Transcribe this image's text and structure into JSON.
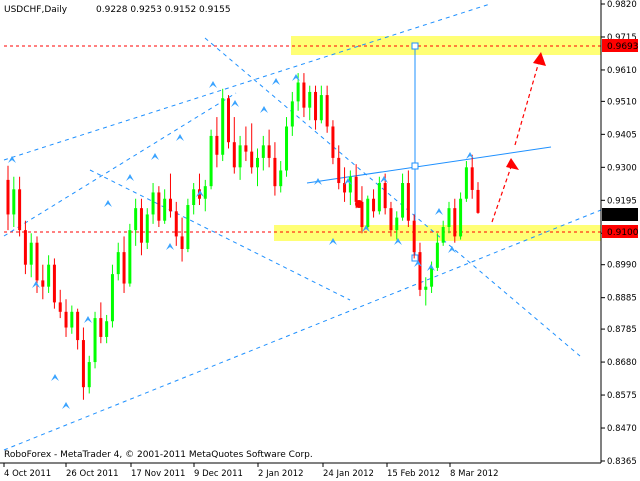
{
  "chart_data": {
    "type": "candlestick",
    "symbol_header": "USDCHF,Daily",
    "ohlc_header": "0.9228 0.9253 0.9152 0.9155",
    "footer": "RoboForex - MetaTrader 4, © 2001-2011 MetaQuotes Software Corp.",
    "ylim": [
      0.8365,
      0.982
    ],
    "y_ticks": [
      "0.9820",
      "0.9715",
      "0.9610",
      "0.9510",
      "0.9405",
      "0.9300",
      "0.9195",
      "0.9090",
      "0.8990",
      "0.8885",
      "0.8785",
      "0.8680",
      "0.8575",
      "0.8470",
      "0.8365"
    ],
    "x_labels": [
      "4 Oct 2011",
      "26 Oct 2011",
      "17 Nov 2011",
      "9 Dec 2011",
      "2 Jan 2012",
      "24 Jan 2012",
      "15 Feb 2012",
      "8 Mar 2012"
    ],
    "price_badges": {
      "target": {
        "label": "0.9693",
        "value": 0.9693,
        "color": "#ff0000"
      },
      "current": {
        "label": "0.9155",
        "value": 0.9155,
        "color": "#000000"
      },
      "support": {
        "label": "0.9100",
        "value": 0.91,
        "color": "#ff0000"
      }
    },
    "bull_color": "#00ff00",
    "bear_color": "#ff0000",
    "zone_color": "#ffff66",
    "line_color": "#1e90ff",
    "candles": [
      [
        0.926,
        0.9305,
        0.91,
        0.915
      ],
      [
        0.915,
        0.927,
        0.911,
        0.923
      ],
      [
        0.923,
        0.927,
        0.908,
        0.91
      ],
      [
        0.91,
        0.913,
        0.896,
        0.899
      ],
      [
        0.899,
        0.909,
        0.895,
        0.906
      ],
      [
        0.906,
        0.908,
        0.89,
        0.894
      ],
      [
        0.894,
        0.899,
        0.888,
        0.892
      ],
      [
        0.892,
        0.902,
        0.89,
        0.899
      ],
      [
        0.899,
        0.901,
        0.885,
        0.887
      ],
      [
        0.887,
        0.891,
        0.882,
        0.884
      ],
      [
        0.884,
        0.888,
        0.876,
        0.879
      ],
      [
        0.879,
        0.886,
        0.877,
        0.884
      ],
      [
        0.884,
        0.885,
        0.872,
        0.875
      ],
      [
        0.875,
        0.879,
        0.856,
        0.86
      ],
      [
        0.86,
        0.87,
        0.858,
        0.868
      ],
      [
        0.868,
        0.884,
        0.866,
        0.882
      ],
      [
        0.882,
        0.887,
        0.874,
        0.876
      ],
      [
        0.876,
        0.883,
        0.874,
        0.881
      ],
      [
        0.881,
        0.899,
        0.879,
        0.896
      ],
      [
        0.896,
        0.906,
        0.894,
        0.903
      ],
      [
        0.903,
        0.908,
        0.89,
        0.893
      ],
      [
        0.893,
        0.912,
        0.892,
        0.91
      ],
      [
        0.91,
        0.92,
        0.905,
        0.917
      ],
      [
        0.917,
        0.92,
        0.902,
        0.906
      ],
      [
        0.906,
        0.917,
        0.904,
        0.915
      ],
      [
        0.915,
        0.925,
        0.912,
        0.922
      ],
      [
        0.922,
        0.924,
        0.911,
        0.913
      ],
      [
        0.913,
        0.923,
        0.912,
        0.92
      ],
      [
        0.92,
        0.928,
        0.914,
        0.916
      ],
      [
        0.916,
        0.919,
        0.905,
        0.908
      ],
      [
        0.908,
        0.914,
        0.9,
        0.904
      ],
      [
        0.904,
        0.92,
        0.903,
        0.918
      ],
      [
        0.918,
        0.925,
        0.915,
        0.923
      ],
      [
        0.923,
        0.928,
        0.918,
        0.92
      ],
      [
        0.92,
        0.926,
        0.916,
        0.924
      ],
      [
        0.924,
        0.942,
        0.923,
        0.94
      ],
      [
        0.94,
        0.946,
        0.93,
        0.934
      ],
      [
        0.934,
        0.955,
        0.932,
        0.952
      ],
      [
        0.952,
        0.953,
        0.936,
        0.938
      ],
      [
        0.938,
        0.946,
        0.928,
        0.93
      ],
      [
        0.93,
        0.94,
        0.926,
        0.937
      ],
      [
        0.937,
        0.943,
        0.932,
        0.935
      ],
      [
        0.935,
        0.944,
        0.928,
        0.93
      ],
      [
        0.93,
        0.936,
        0.924,
        0.933
      ],
      [
        0.933,
        0.94,
        0.929,
        0.937
      ],
      [
        0.937,
        0.942,
        0.93,
        0.933
      ],
      [
        0.933,
        0.938,
        0.921,
        0.924
      ],
      [
        0.924,
        0.932,
        0.922,
        0.929
      ],
      [
        0.929,
        0.946,
        0.927,
        0.943
      ],
      [
        0.943,
        0.954,
        0.94,
        0.951
      ],
      [
        0.951,
        0.96,
        0.948,
        0.957
      ],
      [
        0.957,
        0.96,
        0.946,
        0.949
      ],
      [
        0.949,
        0.956,
        0.945,
        0.954
      ],
      [
        0.954,
        0.956,
        0.942,
        0.945
      ],
      [
        0.945,
        0.956,
        0.944,
        0.953
      ],
      [
        0.953,
        0.956,
        0.941,
        0.943
      ],
      [
        0.943,
        0.945,
        0.931,
        0.933
      ],
      [
        0.933,
        0.937,
        0.923,
        0.925
      ],
      [
        0.925,
        0.93,
        0.919,
        0.922
      ],
      [
        0.922,
        0.929,
        0.918,
        0.927
      ],
      [
        0.927,
        0.931,
        0.917,
        0.919
      ],
      [
        0.919,
        0.924,
        0.909,
        0.911
      ],
      [
        0.911,
        0.921,
        0.91,
        0.92
      ],
      [
        0.92,
        0.923,
        0.914,
        0.916
      ],
      [
        0.916,
        0.927,
        0.915,
        0.925
      ],
      [
        0.925,
        0.928,
        0.915,
        0.917
      ],
      [
        0.917,
        0.919,
        0.908,
        0.91
      ],
      [
        0.91,
        0.916,
        0.907,
        0.914
      ],
      [
        0.914,
        0.928,
        0.913,
        0.925
      ],
      [
        0.925,
        0.929,
        0.911,
        0.913
      ],
      [
        0.913,
        0.915,
        0.901,
        0.903
      ],
      [
        0.903,
        0.906,
        0.889,
        0.891
      ],
      [
        0.891,
        0.895,
        0.886,
        0.892
      ],
      [
        0.892,
        0.9,
        0.89,
        0.898
      ],
      [
        0.898,
        0.909,
        0.897,
        0.906
      ],
      [
        0.906,
        0.913,
        0.905,
        0.911
      ],
      [
        0.911,
        0.919,
        0.909,
        0.917
      ],
      [
        0.917,
        0.92,
        0.906,
        0.908
      ],
      [
        0.908,
        0.922,
        0.907,
        0.92
      ],
      [
        0.92,
        0.932,
        0.919,
        0.93
      ],
      [
        0.93,
        0.934,
        0.92,
        0.9228
      ],
      [
        0.9228,
        0.9253,
        0.9152,
        0.9155
      ]
    ]
  }
}
